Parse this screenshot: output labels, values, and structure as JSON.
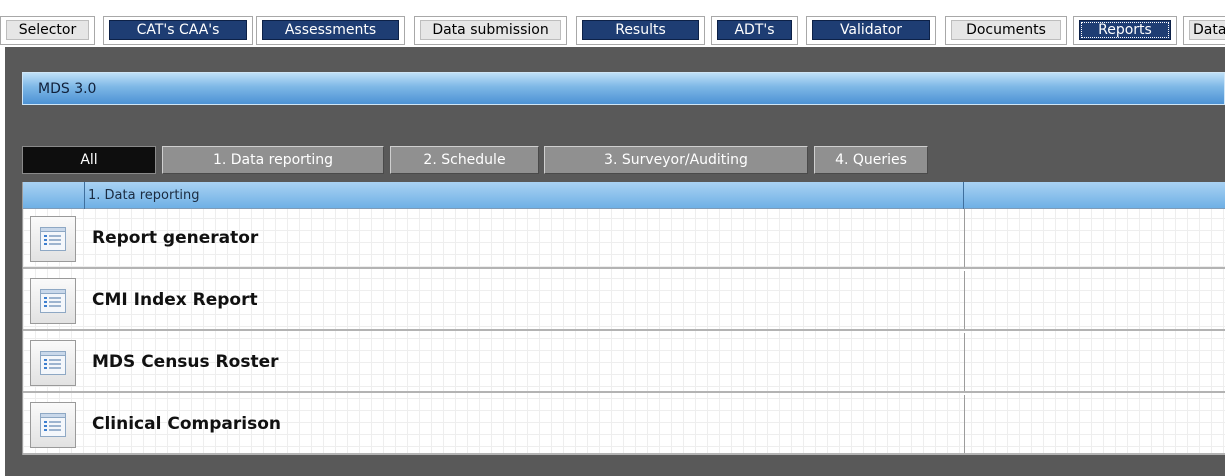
{
  "top_tabs": [
    {
      "label": "Selector",
      "style": "light"
    },
    {
      "label": "CAT's CAA's",
      "style": "dark"
    },
    {
      "label": "Assessments",
      "style": "dark"
    },
    {
      "label": "Data submission",
      "style": "light"
    },
    {
      "label": "Results",
      "style": "dark"
    },
    {
      "label": "ADT's",
      "style": "dark"
    },
    {
      "label": "Validator",
      "style": "dark"
    },
    {
      "label": "Documents",
      "style": "light"
    },
    {
      "label": "Reports",
      "style": "dark",
      "active": true
    },
    {
      "label": "Data",
      "style": "light"
    }
  ],
  "section": {
    "title": "MDS 3.0"
  },
  "filter_tabs": [
    {
      "label": "All",
      "active": true
    },
    {
      "label": "1. Data reporting"
    },
    {
      "label": "2. Schedule"
    },
    {
      "label": "3. Surveyor/Auditing"
    },
    {
      "label": "4. Queries"
    }
  ],
  "grid": {
    "group_header": "1. Data reporting",
    "rows": [
      {
        "label": "Report generator",
        "icon": "report-icon"
      },
      {
        "label": "CMI Index Report",
        "icon": "report-icon"
      },
      {
        "label": "MDS Census Roster",
        "icon": "report-icon"
      },
      {
        "label": "Clinical Comparison",
        "icon": "report-icon"
      }
    ]
  },
  "colors": {
    "panel": "#595959",
    "dark_tab": "#1e3d73",
    "header_blue": "#6fb0e5",
    "active_filter": "#0e0e0e"
  }
}
